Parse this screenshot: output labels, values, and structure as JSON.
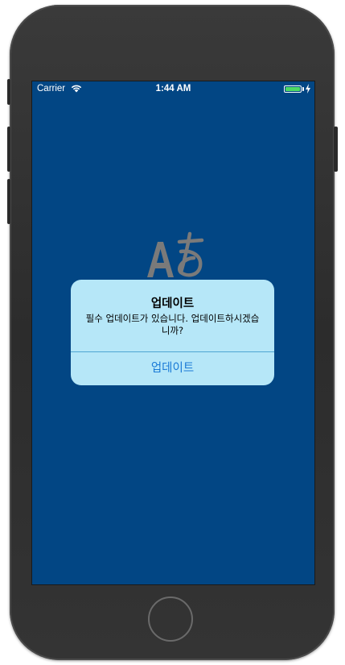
{
  "status_bar": {
    "carrier": "Carrier",
    "time": "1:44 AM",
    "wifi_icon": "wifi-icon",
    "battery_icon": "battery-charging-icon",
    "battery_level": 1.0
  },
  "screen": {
    "background_color": "#024684",
    "center_icon": "translate-icon"
  },
  "alert": {
    "title": "업데이트",
    "message": "필수 업데이트가 있습니다. 업데이트하시겠습니까?",
    "button_label": "업데이트",
    "background_color": "#b6e7f8",
    "button_color": "#1a7ad6"
  },
  "device": {
    "home_button_icon": "home-button-icon"
  }
}
